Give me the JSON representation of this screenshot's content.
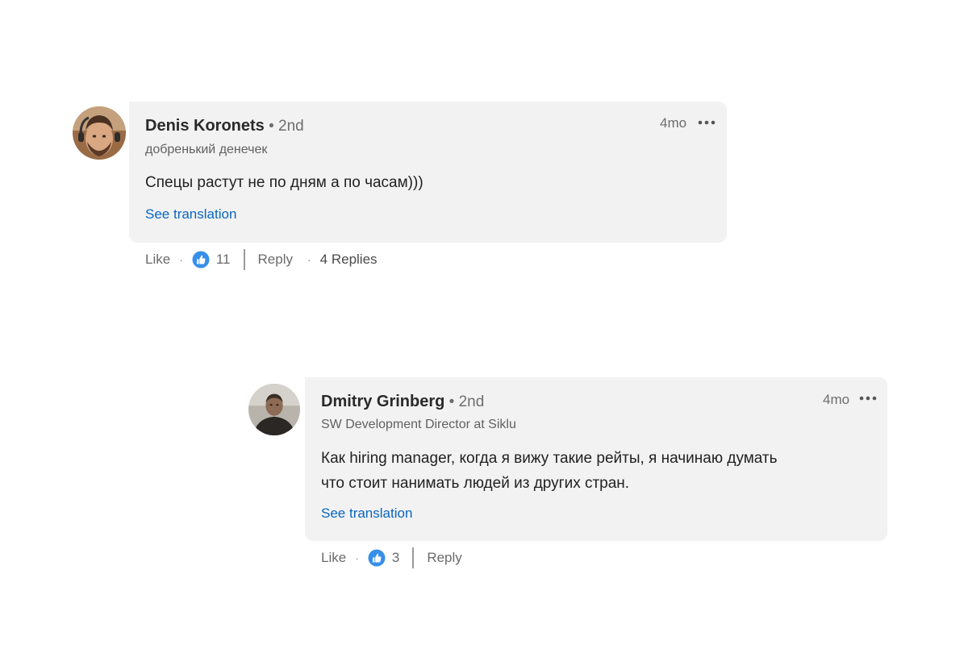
{
  "comments": [
    {
      "author": "Denis Koronets",
      "degree": " • 2nd",
      "headline": "добренький денечек",
      "body": [
        "Спецы растут не по дням а по часам)))"
      ],
      "see_translation": "See translation",
      "timestamp": "4mo",
      "more_icon": "more-horizontal-icon",
      "like_label": "Like",
      "reaction_icon": "thumbs-up-reaction-icon",
      "reaction_count": "11",
      "reply_label": "Reply",
      "replies_label": "4 Replies"
    },
    {
      "author": "Dmitry Grinberg",
      "degree": " • 2nd",
      "headline": "SW Development Director at Siklu",
      "body": [
        "Как hiring manager, когда я вижу такие рейты, я начинаю думать",
        "что стоит нанимать людей из других стран."
      ],
      "see_translation": "See translation",
      "timestamp": "4mo",
      "more_icon": "more-horizontal-icon",
      "like_label": "Like",
      "reaction_icon": "thumbs-up-reaction-icon",
      "reaction_count": "3",
      "reply_label": "Reply"
    }
  ],
  "colors": {
    "bubble": "#f2f2f2",
    "link": "#0a66c2",
    "reaction_blue": "#378fe9"
  }
}
